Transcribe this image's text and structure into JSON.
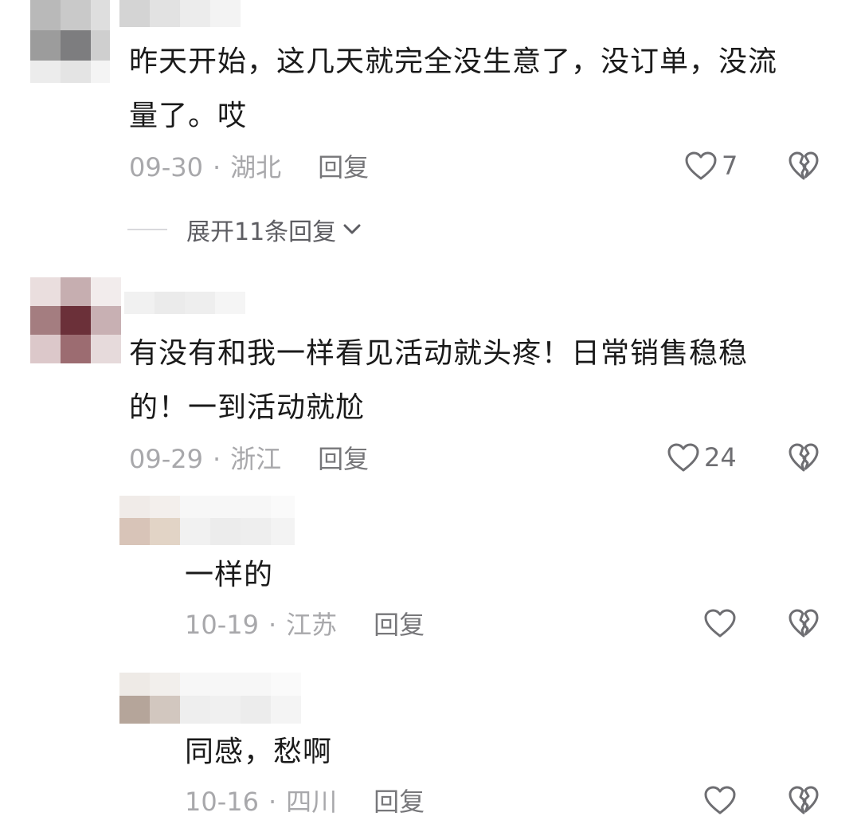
{
  "comments": [
    {
      "text_line1": "昨天开始，这几天就完全没生意了，没订单，没流",
      "text_line2": "量了。哎",
      "date": "09-30",
      "location": "湖北",
      "reply_label": "回复",
      "likes": "7",
      "expand_label": "展开11条回复",
      "replies": [
        {
          "text": "一样的",
          "date": "10-19",
          "location": "江苏",
          "reply_label": "回复"
        },
        {
          "text": "同感，愁啊",
          "date": "10-16",
          "location": "四川",
          "reply_label": "回复"
        }
      ]
    },
    {
      "text_line1": "有没有和我一样看见活动就头疼！日常销售稳稳",
      "text_line2": "的！一到活动就尬",
      "date": "09-29",
      "location": "浙江",
      "reply_label": "回复",
      "likes": "24"
    }
  ],
  "separator": "·",
  "icons": {
    "like": "heart-outline-icon",
    "dislike": "broken-heart-icon",
    "expand": "chevron-down-icon"
  },
  "colors": {
    "text": "#1a1a1a",
    "meta": "#a8a8ab",
    "reply": "#77777a",
    "icon": "#6e6e72"
  }
}
